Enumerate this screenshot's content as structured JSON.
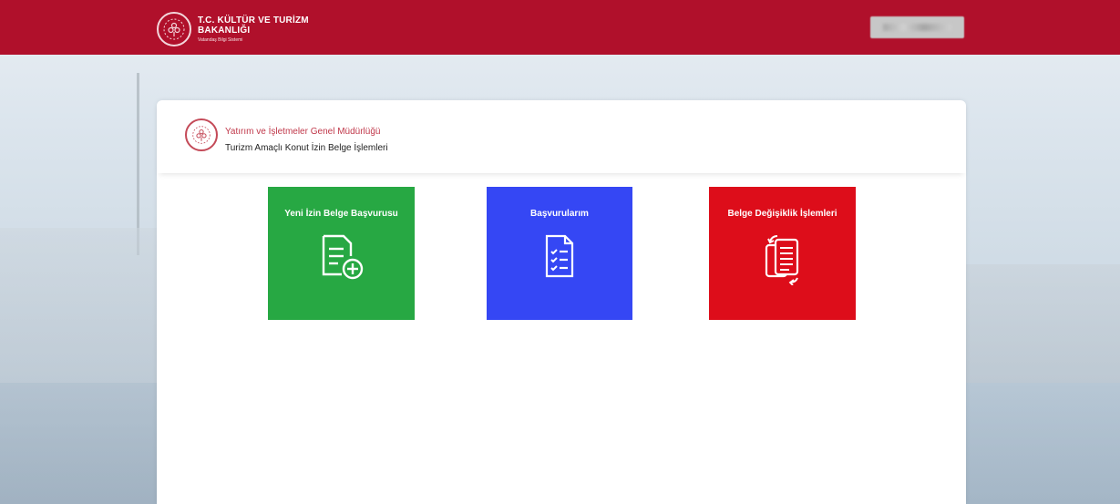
{
  "header": {
    "brand_line1": "T.C. KÜLTÜR VE TURİZM",
    "brand_line2": "BAKANLIĞI",
    "brand_sub": "Vatandaş Bilgi Sistemi"
  },
  "card": {
    "department": "Yatırım ve İşletmeler Genel Müdürlüğü",
    "service": "Turizm Amaçlı Konut İzin Belge İşlemleri"
  },
  "tiles": [
    {
      "label": "Yeni İzin Belge Başvurusu",
      "icon": "document-add-icon",
      "color": "#27a843"
    },
    {
      "label": "Başvurularım",
      "icon": "checklist-document-icon",
      "color": "#3547f4"
    },
    {
      "label": "Belge Değişiklik İşlemleri",
      "icon": "document-swap-icon",
      "color": "#dd0d1a"
    }
  ],
  "colors": {
    "header_bg": "#b0102b",
    "accent_red_text": "#c0384a"
  }
}
